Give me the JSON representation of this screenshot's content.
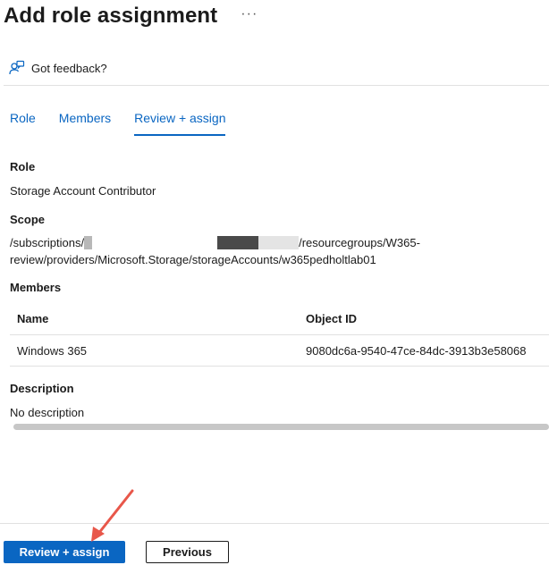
{
  "header": {
    "title": "Add role assignment",
    "more_label": "···"
  },
  "feedback": {
    "label": "Got feedback?",
    "icon": "feedback-icon"
  },
  "tabs": [
    {
      "label": "Role",
      "active": false
    },
    {
      "label": "Members",
      "active": false
    },
    {
      "label": "Review + assign",
      "active": true
    }
  ],
  "role": {
    "heading": "Role",
    "value": "Storage Account Contributor"
  },
  "scope": {
    "heading": "Scope",
    "line1_prefix": "/subscriptions/",
    "line1_suffix": "/resourcegroups/W365-",
    "line2": "review/providers/Microsoft.Storage/storageAccounts/w365pedholtlab01"
  },
  "members": {
    "heading": "Members",
    "columns": [
      "Name",
      "Object ID"
    ],
    "rows": [
      {
        "name": "Windows 365",
        "object_id": "9080dc6a-9540-47ce-84dc-3913b3e58068"
      }
    ]
  },
  "description": {
    "heading": "Description",
    "value": "No description"
  },
  "footer": {
    "primary_label": "Review + assign",
    "secondary_label": "Previous"
  },
  "colors": {
    "accent": "#0a66c2",
    "annotation_arrow": "#e8574a"
  }
}
